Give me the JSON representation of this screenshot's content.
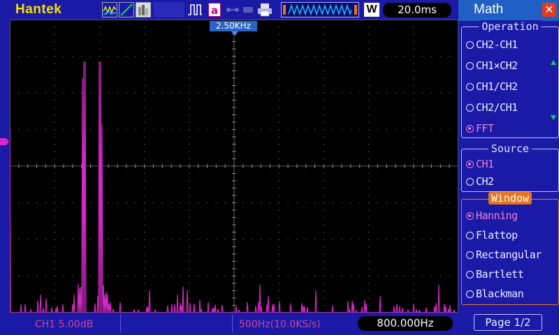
{
  "header": {
    "brand": "Hantek",
    "timebase": "20.0ms",
    "w_label": "W",
    "a_label": "a"
  },
  "trace": {
    "marker_label": "2.50KHz",
    "color": "#d428c8"
  },
  "status": {
    "ch1_scale": "CH1 5.00dB",
    "freq_scale": "500Hz(10.0KS/s)",
    "center_freq": "800.000Hz"
  },
  "panel": {
    "title": "Math",
    "close_icon": "close-icon",
    "operation": {
      "label": "Operation",
      "options": [
        "CH2-CH1",
        "CH1×CH2",
        "CH1/CH2",
        "CH2/CH1",
        "FFT"
      ],
      "selected": "FFT"
    },
    "source": {
      "label": "Source",
      "options": [
        "CH1",
        "CH2"
      ],
      "selected": "CH1"
    },
    "window": {
      "label": "Window",
      "options": [
        "Hanning",
        "Flattop",
        "Rectangular",
        "Bartlett",
        "Blackman"
      ],
      "selected": "Hanning"
    },
    "page": "Page 1/2"
  },
  "colors": {
    "background": "#1a1aa6",
    "accent": "#2060c4",
    "trace": "#d428c8",
    "window_tab": "#e8761e",
    "brand": "#f5e000"
  }
}
